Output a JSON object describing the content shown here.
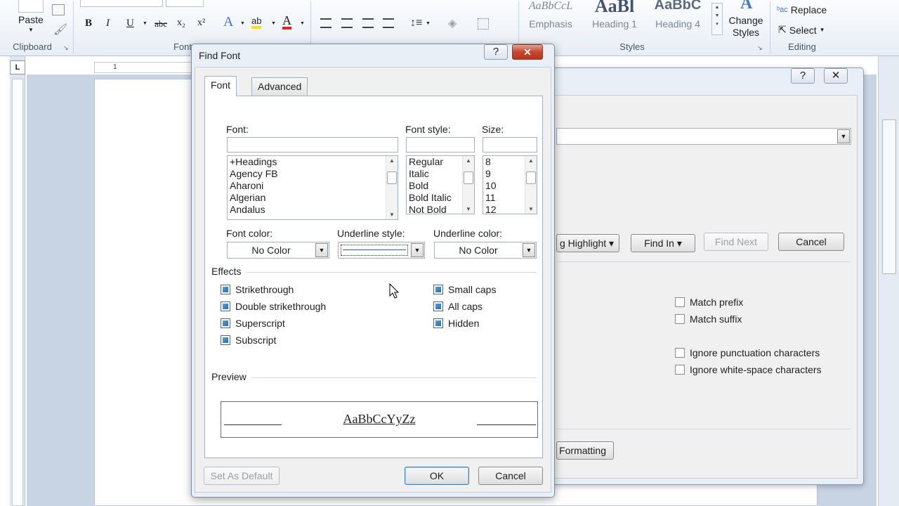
{
  "ribbon": {
    "clipboard": {
      "paste_label": "Paste",
      "group_label": "Clipboard"
    },
    "font": {
      "group_label": "Font",
      "bold": "B",
      "italic": "I",
      "underline": "U",
      "strike": "abc",
      "subscript": "x₂",
      "superscript": "x²",
      "highlight": "ab",
      "fontcolor": "A"
    },
    "styles": {
      "items": [
        {
          "preview": "AaBbCcL",
          "name": "Emphasis"
        },
        {
          "preview": "AaBl",
          "name": "Heading 1"
        },
        {
          "preview": "AaBbC",
          "name": "Heading 4"
        }
      ],
      "change_styles": "Change Styles",
      "group_label": "Styles"
    },
    "editing": {
      "replace_label": "Replace",
      "select_label": "Select",
      "group_label": "Editing"
    }
  },
  "ruler": {
    "corner": "L",
    "marker": "1"
  },
  "back_dialog": {
    "help": "?",
    "close": "✕",
    "buttons": {
      "highlight": "g Highlight ▾",
      "find_in": "Find In ▾",
      "find_next": "Find Next",
      "cancel": "Cancel",
      "formatting": "Formatting"
    },
    "checks": [
      "Match prefix",
      "Match suffix",
      "Ignore punctuation characters",
      "Ignore white-space characters"
    ]
  },
  "find_font": {
    "title": "Find Font",
    "help": "?",
    "close": "✕",
    "tabs": [
      "Font",
      "Advanced"
    ],
    "labels": {
      "font": "Font:",
      "font_style": "Font style:",
      "size": "Size:",
      "font_color": "Font color:",
      "underline_style": "Underline style:",
      "underline_color": "Underline color:",
      "effects": "Effects",
      "preview": "Preview"
    },
    "font_list": [
      "+Headings",
      "Agency FB",
      "Aharoni",
      "Algerian",
      "Andalus"
    ],
    "style_list": [
      "Regular",
      "Italic",
      "Bold",
      "Bold Italic",
      "Not Bold"
    ],
    "size_list": [
      "8",
      "9",
      "10",
      "11",
      "12"
    ],
    "font_color_value": "No Color",
    "underline_color_value": "No Color",
    "effects_left": [
      "Strikethrough",
      "Double strikethrough",
      "Superscript",
      "Subscript"
    ],
    "effects_right": [
      "Small caps",
      "All caps",
      "Hidden"
    ],
    "preview_text": "AaBbCcYyZz",
    "buttons": {
      "set_default": "Set As Default",
      "ok": "OK",
      "cancel": "Cancel"
    }
  }
}
